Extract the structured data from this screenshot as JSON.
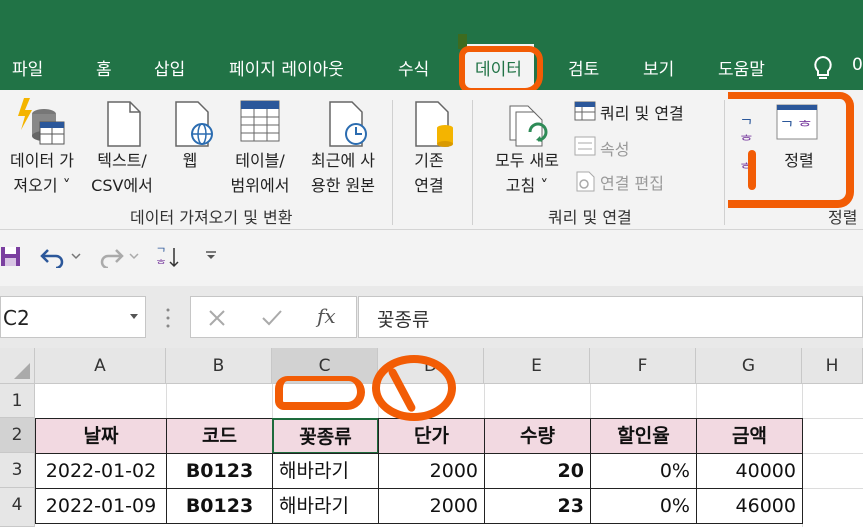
{
  "tabs": [
    "파일",
    "홈",
    "삽입",
    "페이지 레이아웃",
    "수식",
    "데이터",
    "검토",
    "보기",
    "도움말"
  ],
  "tab_active": "데이터",
  "tell_me_partial": "0",
  "ribbon": {
    "get_data": {
      "line1": "데이터 가",
      "line2": "져오기 ˅"
    },
    "from_text": {
      "line1": "텍스트/",
      "line2": "CSV에서"
    },
    "web": {
      "line1": "웹"
    },
    "from_table": {
      "line1": "테이블/",
      "line2": "범위에서"
    },
    "recent": {
      "line1": "최근에 사",
      "line2": "용한 원본"
    },
    "existing": {
      "line1": "기존",
      "line2": "연결"
    },
    "group_get": "데이터 가져오기 및 변환",
    "refresh_all": {
      "line1": "모두 새로",
      "line2": "고침 ˅"
    },
    "queries_connections": "쿼리 및 연결",
    "properties": "속성",
    "edit_links": "연결 편집",
    "group_queries": "쿼리 및 연결",
    "sort": "정렬",
    "group_sort": "정렬"
  },
  "formula_bar": {
    "name_box": "C2",
    "fx": "fx",
    "content": "꽃종류"
  },
  "columns": [
    "A",
    "B",
    "C",
    "D",
    "E",
    "F",
    "G",
    "H"
  ],
  "rows": [
    "1",
    "2",
    "3",
    "4"
  ],
  "table": {
    "headers": [
      "날짜",
      "코드",
      "꽃종류",
      "단가",
      "수량",
      "할인율",
      "금액"
    ],
    "rows": [
      [
        "2022-01-02",
        "B0123",
        "해바라기",
        "2000",
        "20",
        "0%",
        "40000"
      ],
      [
        "2022-01-09",
        "B0123",
        "해바라기",
        "2000",
        "23",
        "0%",
        "46000"
      ]
    ]
  },
  "colors": {
    "excel_green": "#217346",
    "header_fill": "#f2d9e1",
    "annotation": "#f25c05"
  }
}
